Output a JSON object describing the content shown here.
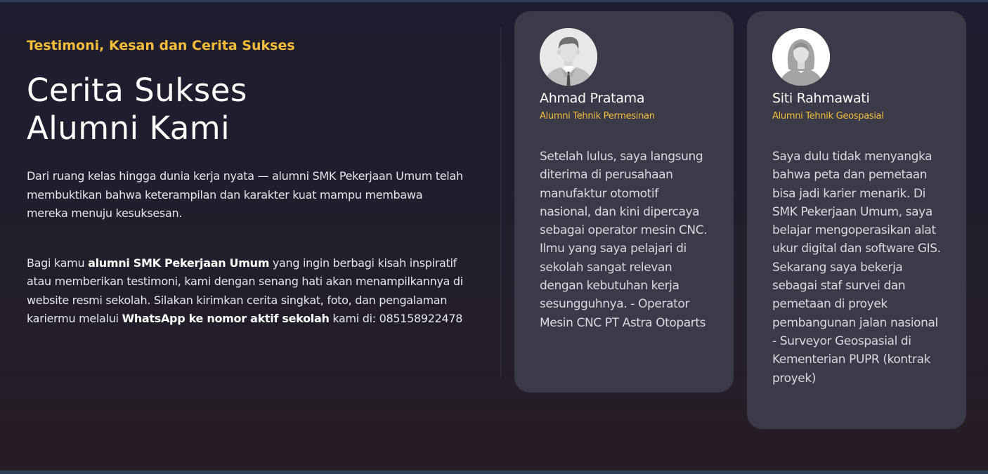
{
  "section": {
    "eyebrow": "Testimoni, Kesan dan Cerita Sukses",
    "heading_line1": "Cerita Sukses",
    "heading_line2": "Alumni Kami",
    "intro": "Dari ruang kelas hingga dunia kerja nyata — alumni SMK Pekerjaan Umum telah membuktikan bahwa keterampilan dan karakter kuat mampu membawa mereka menuju kesuksesan.",
    "cta": {
      "part1": "Bagi kamu ",
      "bold1": "alumni SMK Pekerjaan Umum",
      "part2": " yang ingin berbagi kisah inspiratif atau memberikan testimoni, kami dengan senang hati akan menampilkannya di website resmi sekolah. Silakan kirimkan cerita singkat, foto, dan pengalaman kariermu melalui ",
      "bold2": "WhatsApp ke nomor aktif sekolah",
      "part3": " kami di: ",
      "phone": "085158922478"
    }
  },
  "testimonials": [
    {
      "name": "Ahmad Pratama",
      "role": "Alumni Tehnik Permesinan",
      "avatar_icon": "male-avatar-icon",
      "quote": "Setelah lulus, saya langsung diterima di perusahaan manufaktur otomotif nasional, dan kini dipercaya sebagai operator mesin CNC. Ilmu yang saya pelajari di sekolah sangat relevan dengan kebutuhan kerja sesungguhnya. - Operator Mesin CNC PT Astra Otoparts"
    },
    {
      "name": "Siti Rahmawati",
      "role": "Alumni Tehnik Geospasial",
      "avatar_icon": "female-avatar-icon",
      "quote": "Saya dulu tidak menyangka bahwa peta dan pemetaan bisa jadi karier menarik. Di SMK Pekerjaan Umum, saya belajar mengoperasikan alat ukur digital dan software GIS. Sekarang saya bekerja sebagai staf survei dan pemetaan di proyek pembangunan jalan nasional - Surveyor Geospasial di Kementerian PUPR (kontrak proyek)"
    }
  ],
  "colors": {
    "accent": "#f5bd3a",
    "card": "#3a3a48",
    "background": "#1f1e2d"
  }
}
